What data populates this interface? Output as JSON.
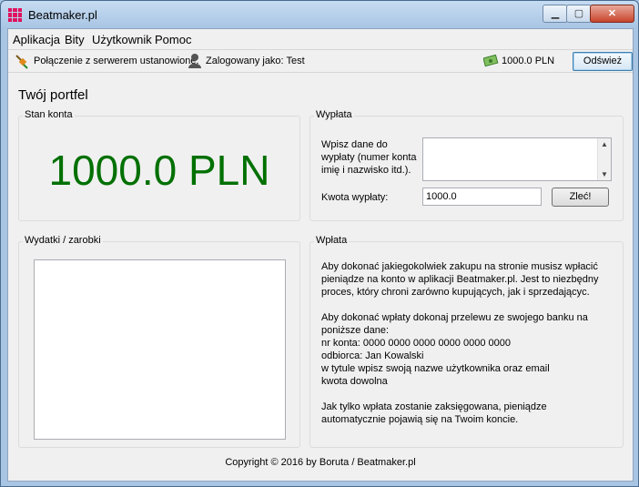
{
  "window": {
    "title": "Beatmaker.pl",
    "minimize_label": "▁",
    "maximize_label": "▢",
    "close_label": "✕"
  },
  "menu": [
    "Aplikacja",
    "Bity",
    "Użytkownik",
    "Pomoc"
  ],
  "status": {
    "connection": "Połączenie z serwerem ustanowione.",
    "logged_in": "Zalogowany jako: Test",
    "balance": "1000.0 PLN",
    "refresh_label": "Odśwież"
  },
  "heading": "Twój portfel",
  "account": {
    "title": "Stan konta",
    "balance": "1000.0 PLN"
  },
  "withdraw": {
    "title": "Wypłata",
    "details_label": "Wpisz dane do wypłaty (numer konta imię i nazwisko itd.).",
    "details_value": "",
    "amount_label": "Kwota wypłaty:",
    "amount_value": "1000.0",
    "submit_label": "Zleć!"
  },
  "history": {
    "title": "Wydatki / zarobki"
  },
  "deposit": {
    "title": "Wpłata",
    "paragraph1": "Aby dokonać jakiegokolwiek zakupu na stronie musisz wpłacić pieniądze na konto w aplikacji Beatmaker.pl. Jest to niezbędny proces, który chroni zarówno kupujących, jak i sprzedającyc.",
    "intro": "Aby dokonać wpłaty dokonaj przelewu ze swojego banku na poniższe dane:",
    "account_number": "nr konta: 0000 0000 0000 0000 0000 0000",
    "recipient": "odbiorca: Jan Kowalski",
    "title_line": "w tytule wpisz swoją nazwe użytkownika oraz email",
    "amount_line": "kwota dowolna",
    "paragraph3": "Jak tylko wpłata zostanie zaksięgowana, pieniądze automatycznie pojawią się na Twoim koncie."
  },
  "footer": "Copyright © 2016 by Boruta / Beatmaker.pl",
  "colors": {
    "balance": "#007000",
    "accent": "#e0115f"
  },
  "icons": [
    "app-grid-icon",
    "connection-plug-icon",
    "user-icon",
    "money-icon"
  ]
}
